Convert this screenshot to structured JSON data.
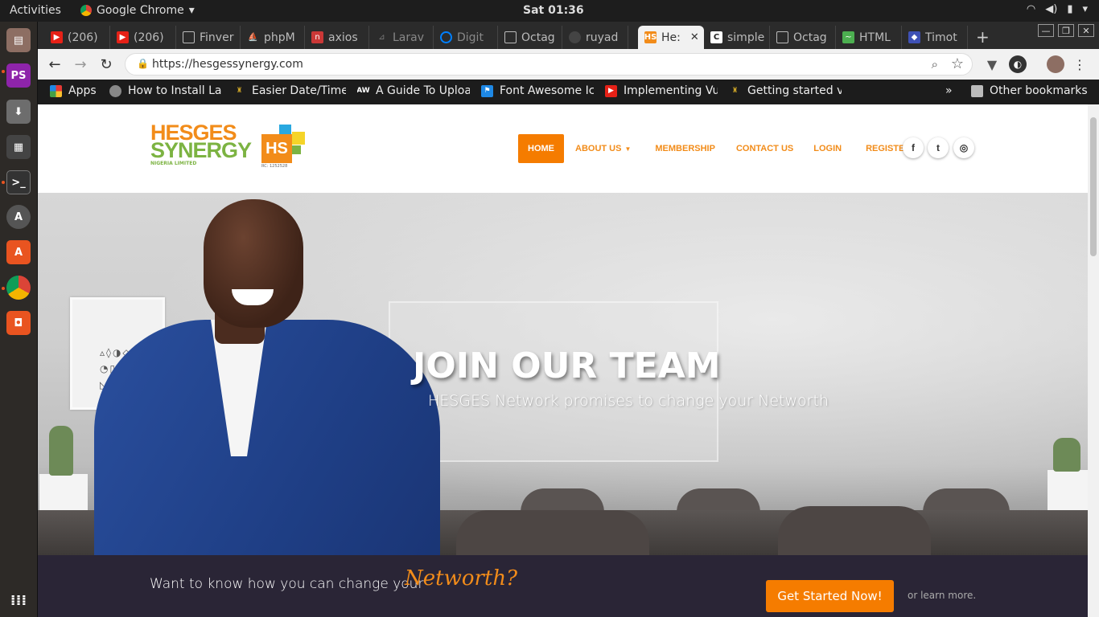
{
  "system": {
    "activities": "Activities",
    "app_name": "Google Chrome",
    "clock": "Sat 01:36"
  },
  "tabs": [
    {
      "label": "(206)",
      "favicon": "youtube-icon",
      "color": "#e62117"
    },
    {
      "label": "(206)",
      "favicon": "youtube-icon",
      "color": "#e62117"
    },
    {
      "label": "Finver",
      "favicon": "document-icon",
      "color": "#777777"
    },
    {
      "label": "phpM",
      "favicon": "phpmyadmin-icon",
      "color": "#f29111"
    },
    {
      "label": "axios",
      "favicon": "npm-icon",
      "color": "#cb3837"
    },
    {
      "label": "Larav",
      "favicon": "laravel-icon",
      "color": "#555555"
    },
    {
      "label": "Digit",
      "favicon": "digitalocean-icon",
      "color": "#0080ff"
    },
    {
      "label": "Octag",
      "favicon": "document-icon",
      "color": "#777777"
    },
    {
      "label": "ruyad",
      "favicon": "github-icon",
      "color": "#444444"
    },
    {
      "label": "He:",
      "favicon": "hs-icon",
      "color": "#f28c1a",
      "active": true
    },
    {
      "label": "simple",
      "favicon": "c-icon",
      "color": "#ffffff"
    },
    {
      "label": "Octag",
      "favicon": "document-icon",
      "color": "#777777"
    },
    {
      "label": "HTML",
      "favicon": "html-icon",
      "color": "#4caf50"
    },
    {
      "label": "Timot",
      "favicon": "shield-icon",
      "color": "#3f51b5"
    }
  ],
  "address_bar": {
    "url": "https://hesgessynergy.com"
  },
  "bookmarks": [
    {
      "label": "Apps",
      "icon": "apps-grid-icon",
      "color": "#e53935"
    },
    {
      "label": "How to Install La",
      "icon": "globe-icon",
      "color": "#888888"
    },
    {
      "label": "Easier Date/Time",
      "icon": "lamp-icon",
      "color": "#c9a227"
    },
    {
      "label": "A Guide To Uploa",
      "icon": "aw-icon",
      "color": "#333333"
    },
    {
      "label": "Font Awesome Ic",
      "icon": "flag-icon",
      "color": "#1e88e5"
    },
    {
      "label": "Implementing Vu",
      "icon": "youtube-icon",
      "color": "#e62117"
    },
    {
      "label": "Getting started v",
      "icon": "lamp-icon",
      "color": "#c9a227"
    }
  ],
  "bookmarks_more": "»",
  "other_bookmarks": "Other bookmarks",
  "site": {
    "logo": {
      "line1": "HESGES",
      "line2": "SYNERGY",
      "line3": "NIGERIA LIMITED",
      "mark": "HS",
      "rc": "RC: 1252528"
    },
    "nav": {
      "home": "HOME",
      "about": "ABOUT US",
      "membership": "MEMBERSHIP",
      "contact": "CONTACT US",
      "login": "LOGIN",
      "register": "REGISTER"
    },
    "social": {
      "facebook": "f",
      "twitter": "t",
      "instagram": "◎"
    },
    "hero": {
      "title": "JOIN OUR TEAM",
      "subtitle": "HESGES Network promises to change your Networth"
    },
    "cta": {
      "text": "Want to know how you can change your",
      "accent": "Networth?",
      "button": "Get Started Now!",
      "more": "or learn more."
    }
  },
  "colors": {
    "brand_orange": "#f28c1a",
    "brand_green": "#7cb342",
    "cta_band": "#2a2536"
  }
}
